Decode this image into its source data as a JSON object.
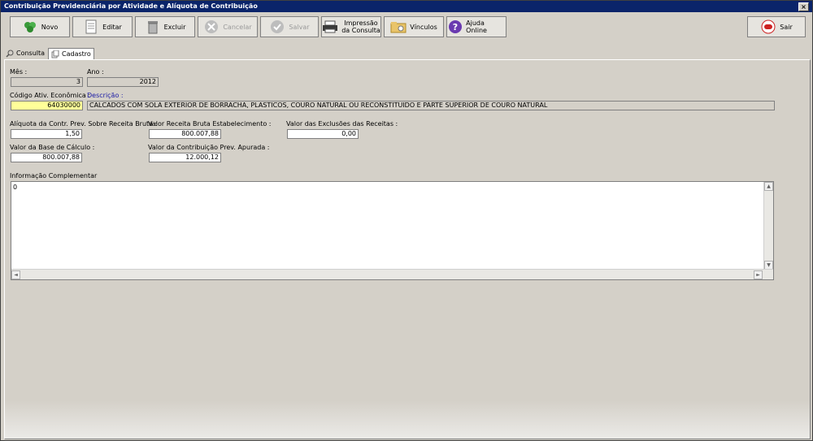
{
  "window": {
    "title": "Contribuição Previdenciária por Atividade e Alíquota de Contribuição",
    "close_label": "×"
  },
  "toolbar": {
    "novo": "Novo",
    "editar": "Editar",
    "excluir": "Excluir",
    "cancelar": "Cancelar",
    "salvar": "Salvar",
    "impressao_line1": "Impressão",
    "impressao_line2": "da Consulta",
    "vinculos": "Vínculos",
    "ajuda": "Ajuda Online",
    "sair": "Sair"
  },
  "tabs": {
    "consulta": "Consulta",
    "cadastro": "Cadastro"
  },
  "form": {
    "mes_label": "Mês :",
    "mes_value": "3",
    "ano_label": "Ano :",
    "ano_value": "2012",
    "codigo_label": "Código Ativ. Econômica :",
    "codigo_value": "64030000",
    "descricao_label": "Descrição :",
    "descricao_value": "CALCADOS COM SOLA EXTERIOR DE BORRACHA, PLASTICOS, COURO NATURAL OU RECONSTITUIDO E PARTE SUPERIOR DE COURO NATURAL",
    "aliquota_label": "Alíquota da Contr. Prev. Sobre Receita Bruta :",
    "aliquota_value": "1,50",
    "receita_label": "Valor Receita Bruta Estabelecimento :",
    "receita_value": "800.007,88",
    "exclusoes_label": "Valor das Exclusões das Receitas :",
    "exclusoes_value": "0,00",
    "base_label": "Valor da Base de Cálculo :",
    "base_value": "800.007,88",
    "contribuicao_label": "Valor da Contribuição Prev. Apurada :",
    "contribuicao_value": "12.000,12",
    "info_label": "Informação Complementar",
    "info_value": "0"
  }
}
